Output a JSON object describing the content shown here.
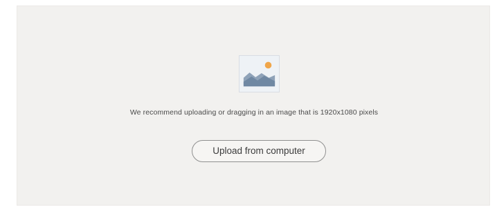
{
  "upload_panel": {
    "icon": "image-icon",
    "recommendation_text": "We recommend uploading or dragging in an image that is 1920x1080 pixels",
    "upload_button_label": "Upload from computer"
  },
  "colors": {
    "panel_background": "#f2f1ef",
    "icon_mountains": "#6f88a3",
    "icon_sun": "#f0a64a",
    "button_border": "#8f8f8f"
  }
}
